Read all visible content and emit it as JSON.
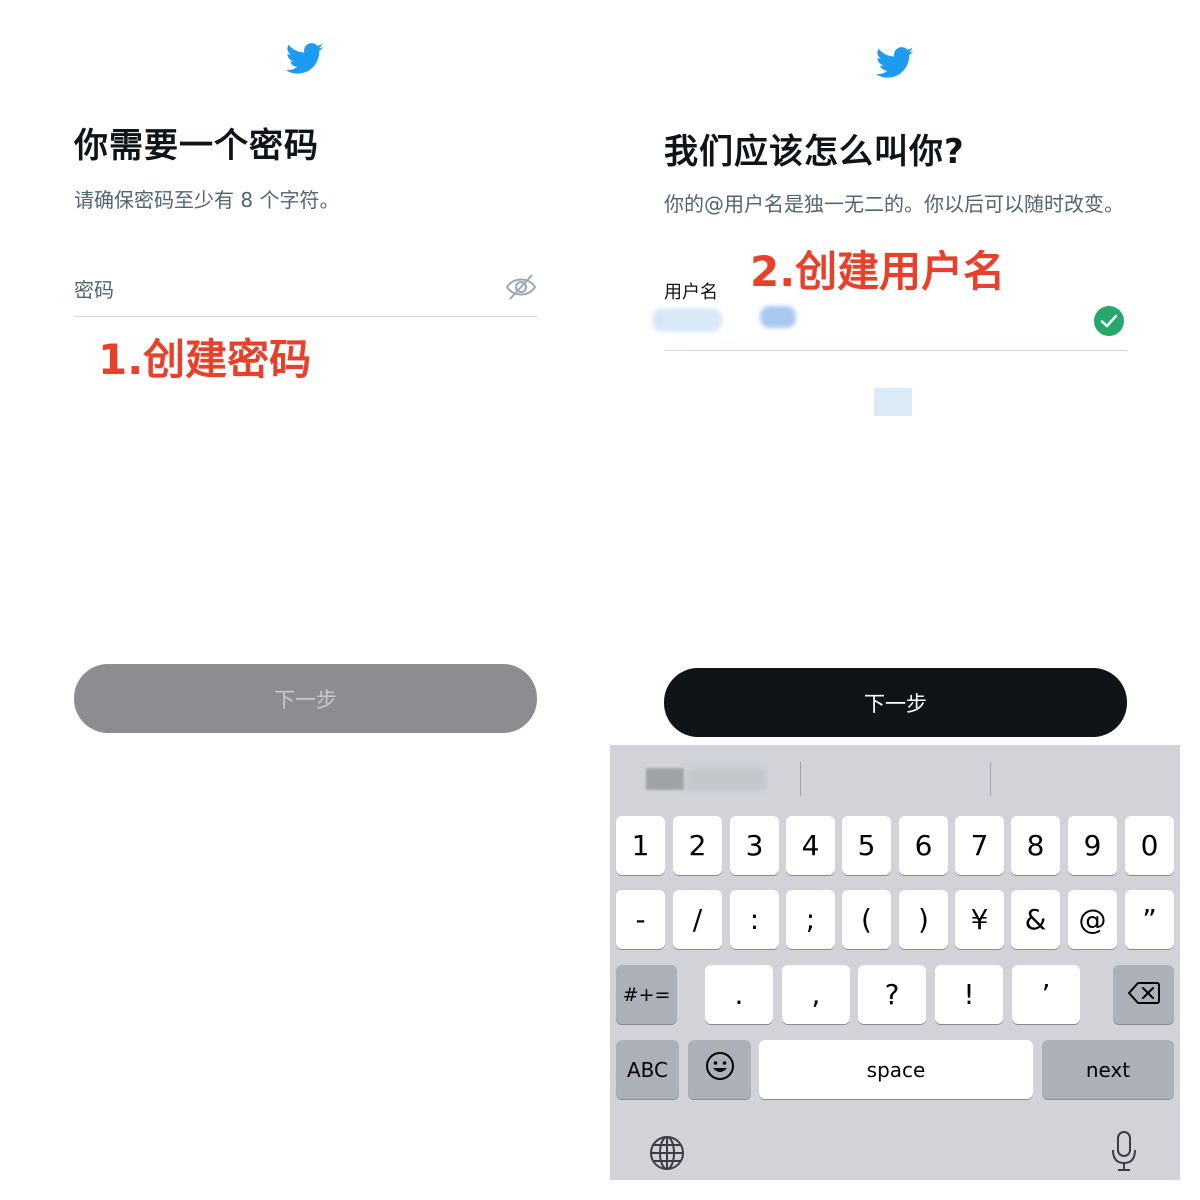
{
  "left": {
    "title": "你需要一个密码",
    "subtitle": "请确保密码至少有 8 个字符。",
    "password_label": "密码",
    "annotation": "1.创建密码",
    "next_button": "下一步"
  },
  "right": {
    "title": "我们应该怎么叫你?",
    "subtitle": "你的@用户名是独一无二的。你以后可以随时改变。",
    "username_label": "用户名",
    "annotation": "2.创建用户名",
    "next_button": "下一步"
  },
  "keyboard": {
    "row1": [
      "1",
      "2",
      "3",
      "4",
      "5",
      "6",
      "7",
      "8",
      "9",
      "0"
    ],
    "row2": [
      "-",
      "/",
      ":",
      ";",
      "(",
      ")",
      "¥",
      "&",
      "@",
      "”"
    ],
    "row3": [
      ".",
      ",",
      "?",
      "!",
      "’"
    ],
    "symbols_key": "#+=",
    "abc_key": "ABC",
    "space_key": "space",
    "next_key": "next"
  },
  "colors": {
    "brand": "#1d9bf0",
    "annotation": "#e8402a",
    "success": "#26a86b"
  },
  "icons": {
    "bird": "twitter-bird-icon",
    "eye": "eye-off-icon",
    "check": "check-circle-icon",
    "backspace": "backspace-icon",
    "emoji": "emoji-icon",
    "globe": "globe-icon",
    "mic": "microphone-icon"
  }
}
